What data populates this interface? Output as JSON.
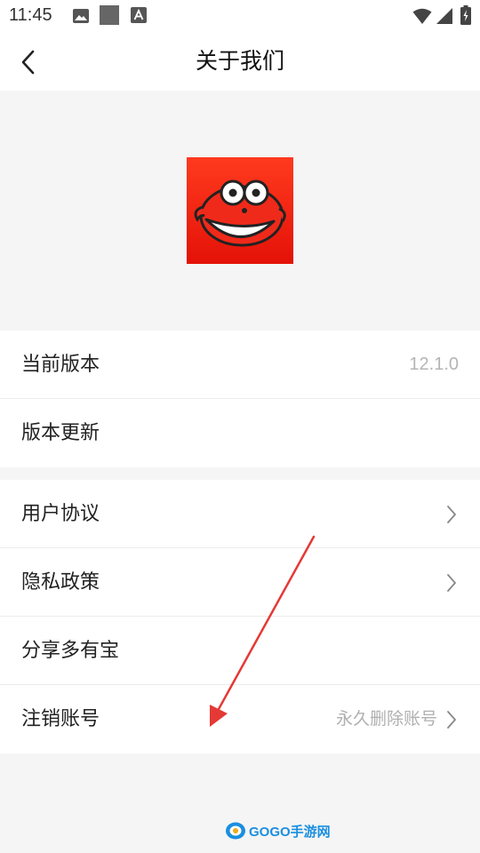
{
  "status_bar": {
    "time": "11:45",
    "icons": [
      "image-icon",
      "square-icon",
      "a-icon",
      "wifi-icon",
      "signal-icon",
      "battery-icon"
    ]
  },
  "header": {
    "title": "关于我们",
    "back_icon": "chevron-left-icon"
  },
  "app_logo": {
    "icon": "fish-mascot-icon",
    "color": "#f02010"
  },
  "info_group": [
    {
      "label": "当前版本",
      "value": "12.1.0"
    },
    {
      "label": "版本更新"
    }
  ],
  "menu_group": [
    {
      "label": "用户协议",
      "chevron": true
    },
    {
      "label": "隐私政策",
      "chevron": true
    },
    {
      "label": "分享多有宝",
      "chevron": false
    },
    {
      "label": "注销账号",
      "hint": "永久删除账号",
      "chevron": true
    }
  ],
  "annotation": {
    "type": "arrow",
    "color": "#e53935"
  },
  "watermark": {
    "text": "GOGO手游网"
  }
}
